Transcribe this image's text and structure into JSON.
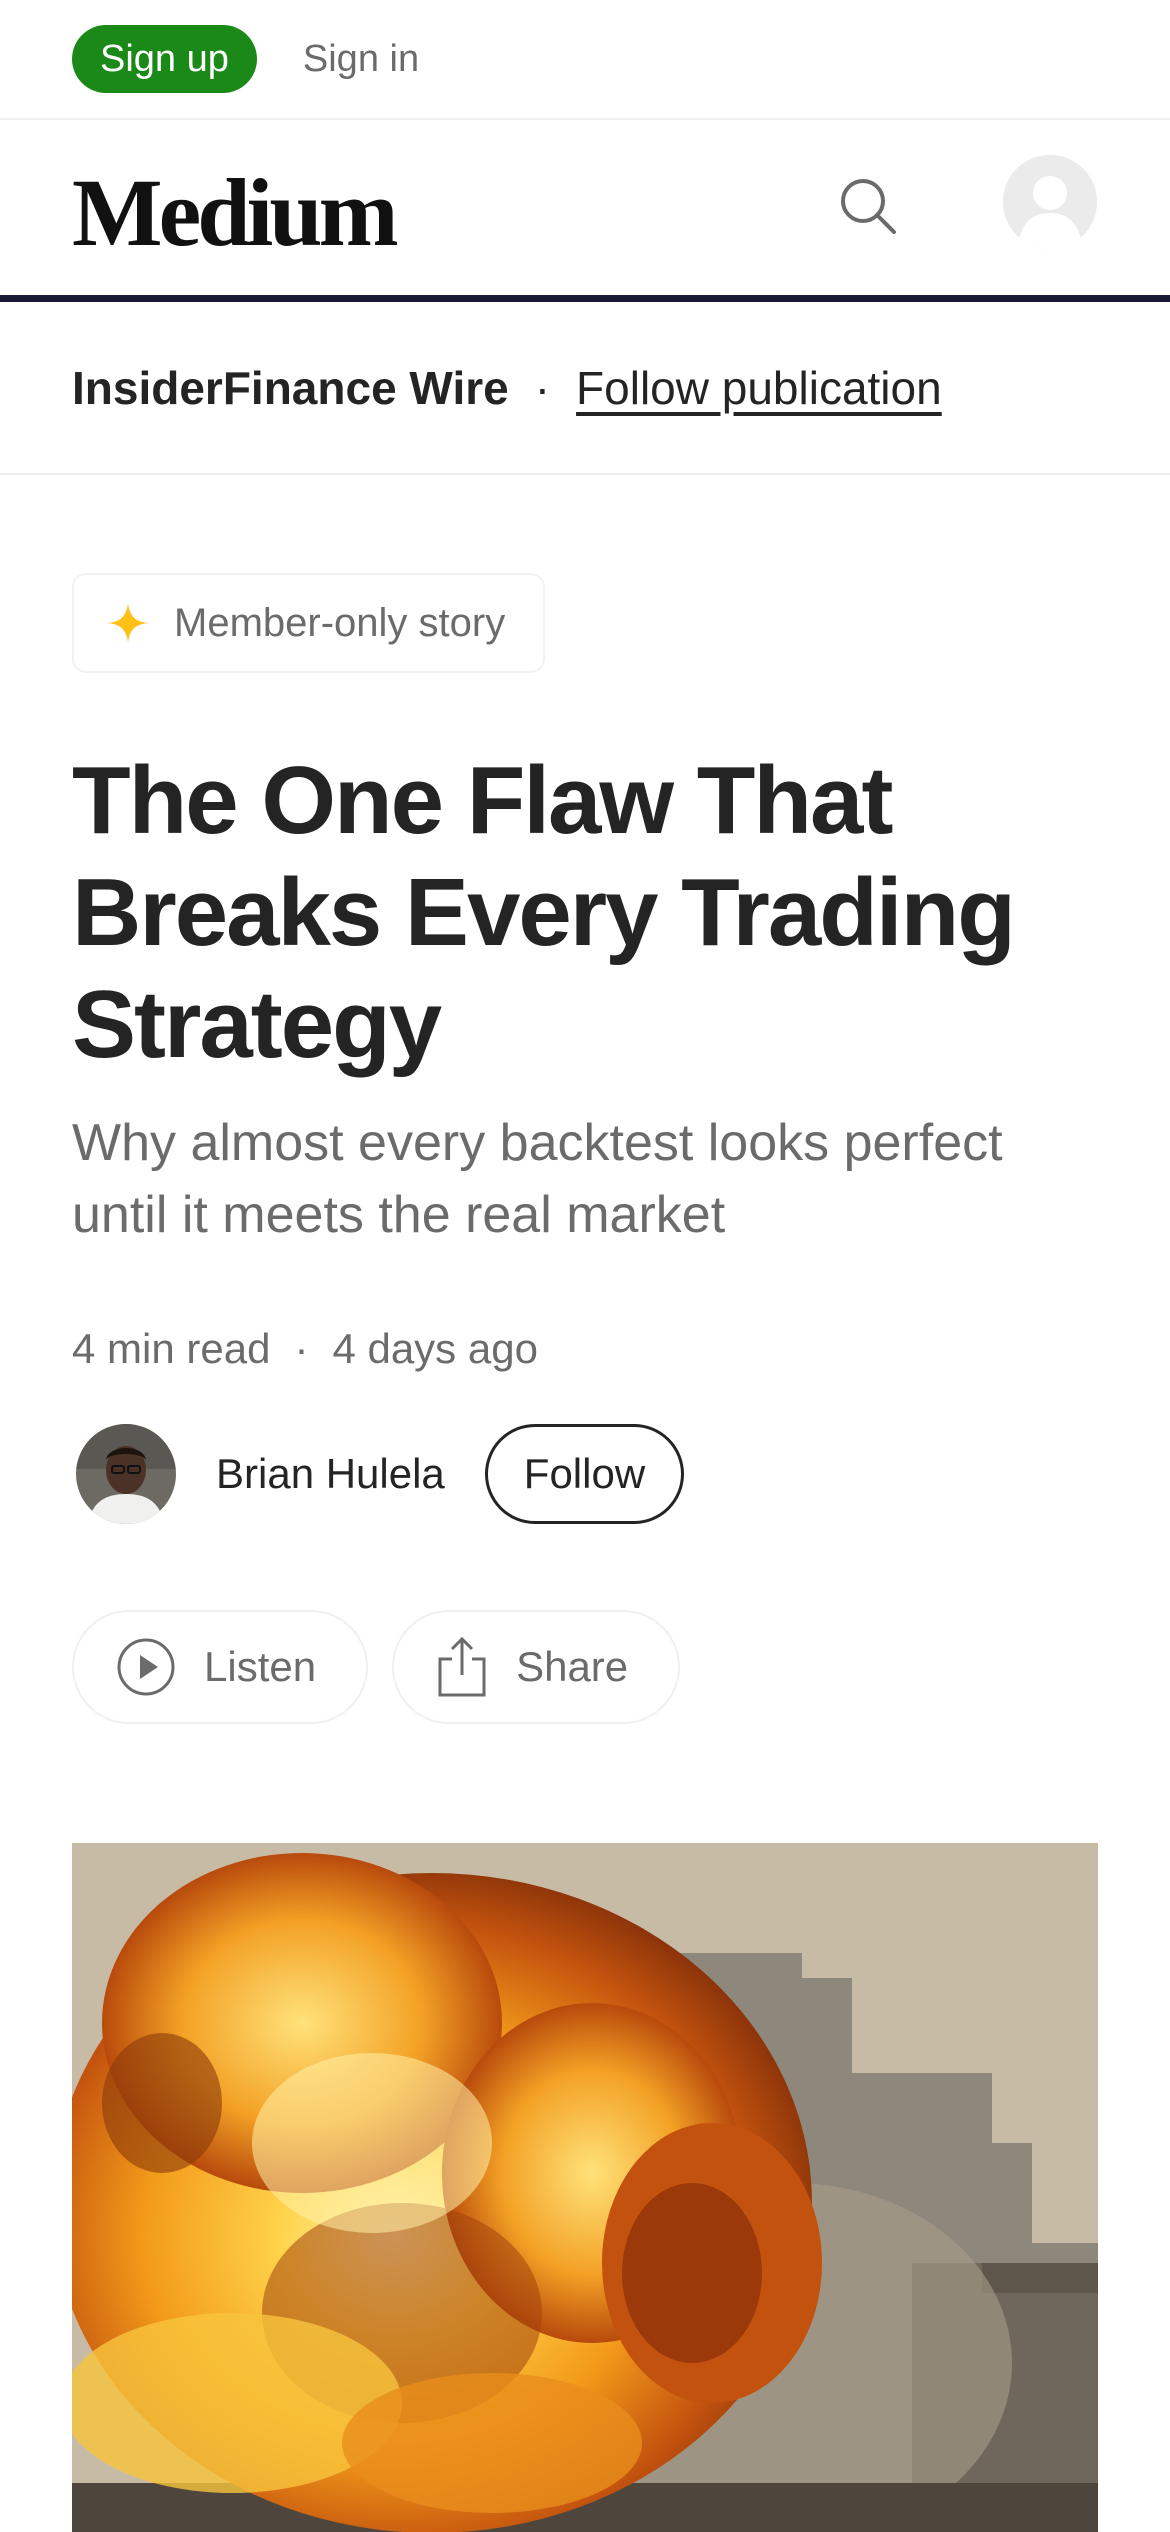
{
  "auth": {
    "signup_label": "Sign up",
    "signin_label": "Sign in"
  },
  "header": {
    "logo": "Medium",
    "search_icon": "search-icon",
    "avatar_icon": "user-avatar-icon"
  },
  "publication": {
    "name": "InsiderFinance Wire",
    "separator": "·",
    "follow_label": "Follow publication"
  },
  "badge": {
    "icon": "star-icon",
    "label": "Member-only story"
  },
  "article": {
    "title": "The One Flaw That Breaks Every Trading Strategy",
    "subtitle": "Why almost every backtest looks perfect until it meets the real market",
    "read_time": "4 min read",
    "separator": "·",
    "published": "4 days ago"
  },
  "author": {
    "name": "Brian Hulela",
    "follow_label": "Follow"
  },
  "actions": {
    "listen_label": "Listen",
    "share_label": "Share"
  },
  "hero_image": {
    "subject": "explosion fireball near building"
  },
  "colors": {
    "brand_green": "#1a8917",
    "text": "#242424",
    "muted": "#6b6b6b",
    "rule": "#191938",
    "star": "#ffc017"
  }
}
